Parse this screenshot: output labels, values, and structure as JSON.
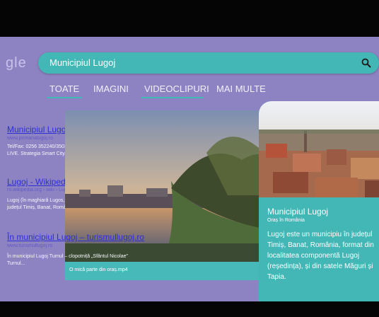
{
  "logo": {
    "text": "gle"
  },
  "search": {
    "query": "Municipiul Lugoj"
  },
  "tabs": [
    {
      "label": "TOATE",
      "active": true
    },
    {
      "label": "IMAGINI",
      "active": false
    },
    {
      "label": "VIDEOCLIPURI",
      "active": false
    },
    {
      "label": "MAI MULTE",
      "active": false
    }
  ],
  "results": [
    {
      "title": "Municipiul Lugoj, Județul Timiș",
      "url": "www.primarialugoj.ro",
      "snippet": "Tel/Fax: 0256 352240/350393. Email: contact@primarialugoj.ro. Lugojul LIVE. Strategia Smart City..."
    },
    {
      "title": "Lugoj - Wikipedia",
      "url": "ro.wikipedia.org › wiki › Lugoj",
      "snippet": "Lugoj (în maghiară Lugos, în germană Lugosch) este un municipiu în județul Timiș, Banat, România..."
    },
    {
      "title": "În municipiul Lugoj – turismullugoj.ro",
      "url": "www.turismullugoj.ro",
      "snippet": "În municipiul Lugoj Turnul – clopotniță „Sfântul Nicolae” Turnul..."
    }
  ],
  "video": {
    "caption": "O mică parte din oraș.mp4"
  },
  "knowledge_panel": {
    "title": "Municipiul Lugoj",
    "subtitle": "Oraș în România",
    "description": "Lugoj este un municipiu în județul Timiș, Banat, România, format din localitatea componentă Lugoj (reședința), și din satele Măguri și Tapia."
  },
  "colors": {
    "background": "#8e83c2",
    "accent": "#43b7b6",
    "link": "#2b2fd4"
  },
  "icons": {
    "search": "magnifier-icon"
  }
}
